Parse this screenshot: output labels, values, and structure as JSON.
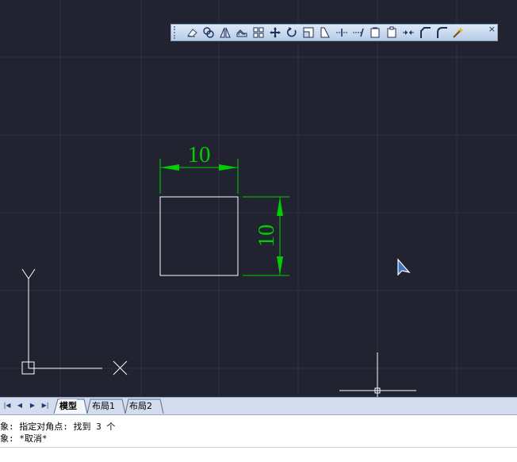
{
  "toolbar": {
    "buttons": [
      {
        "name": "erase-icon"
      },
      {
        "name": "copy-icon"
      },
      {
        "name": "mirror-icon"
      },
      {
        "name": "offset-icon"
      },
      {
        "name": "array-icon"
      },
      {
        "name": "move-icon"
      },
      {
        "name": "rotate-icon"
      },
      {
        "name": "scale-icon"
      },
      {
        "name": "stretch-icon"
      },
      {
        "name": "trim-icon"
      },
      {
        "name": "extend-icon"
      },
      {
        "name": "break-at-point-icon"
      },
      {
        "name": "break-icon"
      },
      {
        "name": "join-icon"
      },
      {
        "name": "chamfer-icon"
      },
      {
        "name": "fillet-icon"
      },
      {
        "name": "explode-icon"
      }
    ],
    "close_label": "×"
  },
  "drawing": {
    "dim_horizontal": "10",
    "dim_vertical": "10",
    "ucs_y_label": "Y",
    "ucs_x_label": "X"
  },
  "colors": {
    "background": "#212330",
    "dimension": "#00cc00",
    "geometry": "#ffffff"
  },
  "tabs": {
    "nav": [
      "|◀",
      "◀",
      "▶",
      "▶|"
    ],
    "items": [
      {
        "label": "模型",
        "active": true
      },
      {
        "label": "布局1",
        "active": false
      },
      {
        "label": "布局2",
        "active": false
      }
    ]
  },
  "command": {
    "line1": "象: 指定对角点: 找到 3 个",
    "line2": "象: *取消*",
    "input": ""
  }
}
